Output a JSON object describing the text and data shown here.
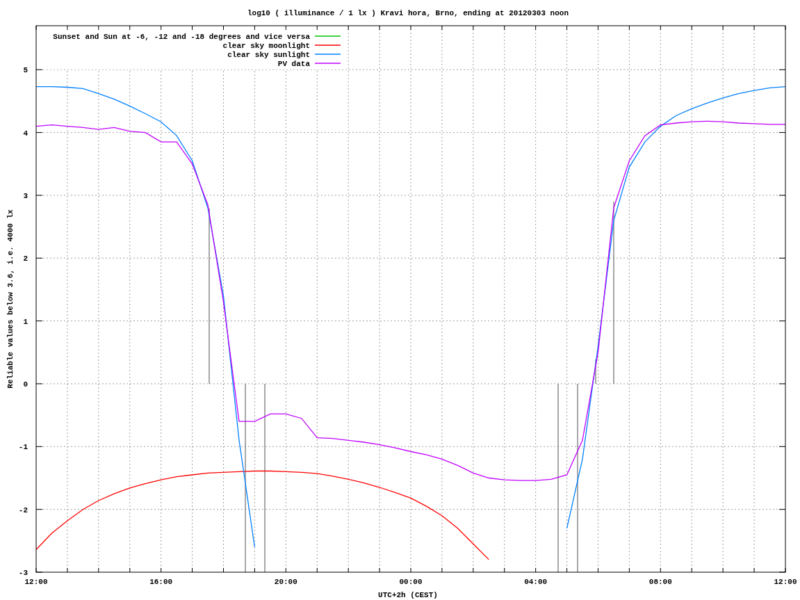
{
  "chart_data": {
    "type": "line",
    "title": "log10 ( illuminance / 1 lx ) Kravi hora, Brno, ending at 20120303 noon",
    "xlabel": "UTC+2h (CEST)",
    "ylabel": "Reliable values below 3.6, i.e. 4000 lx",
    "ylim": [
      -3,
      5.7
    ],
    "grid": true,
    "legend": true,
    "yticks": [
      -3,
      -2,
      -1,
      0,
      1,
      2,
      3,
      4,
      5
    ],
    "categories": [
      "12:00",
      null,
      null,
      null,
      null,
      null,
      null,
      null,
      "16:00",
      null,
      null,
      null,
      null,
      null,
      null,
      null,
      "20:00",
      null,
      null,
      null,
      null,
      null,
      null,
      null,
      "00:00",
      null,
      null,
      null,
      null,
      null,
      null,
      null,
      "04:00",
      null,
      null,
      null,
      null,
      null,
      null,
      null,
      "08:00",
      null,
      null,
      null,
      null,
      null,
      null,
      null,
      "12:00"
    ],
    "series": [
      {
        "name": "Sunset and Sun at -6, -12 and -18 degrees and vice versa",
        "color": "#00c000",
        "values": [
          null,
          null,
          null,
          null,
          null,
          null,
          null,
          null,
          null,
          null,
          null,
          null,
          null,
          null,
          null,
          null,
          null,
          null,
          null,
          null,
          null,
          null,
          null,
          null,
          null,
          null,
          null,
          null,
          null,
          null,
          null,
          null,
          null,
          null,
          null,
          null,
          null,
          null,
          null,
          null,
          null,
          null,
          null,
          null,
          null,
          null,
          null,
          null,
          null
        ]
      },
      {
        "name": "clear sky moonlight",
        "color": "#ff0000",
        "values": [
          -2.64,
          -2.38,
          -2.18,
          -2.0,
          -1.86,
          -1.75,
          -1.66,
          -1.59,
          -1.53,
          -1.48,
          -1.45,
          -1.42,
          -1.41,
          -1.4,
          -1.39,
          -1.39,
          -1.4,
          -1.41,
          -1.43,
          -1.47,
          -1.52,
          -1.58,
          -1.65,
          -1.73,
          -1.82,
          -1.95,
          -2.1,
          -2.3,
          -2.55,
          -2.8,
          null,
          null,
          null,
          null,
          null,
          null,
          null,
          null,
          null,
          null,
          null,
          null,
          null,
          null,
          null,
          null,
          null,
          null,
          null
        ]
      },
      {
        "name": "clear sky sunlight",
        "color": "#0080ff",
        "values": [
          4.73,
          4.73,
          4.72,
          4.7,
          4.62,
          4.53,
          4.42,
          4.3,
          4.17,
          3.95,
          3.55,
          2.8,
          1.4,
          -0.9,
          -2.6,
          null,
          null,
          null,
          null,
          null,
          null,
          null,
          null,
          null,
          null,
          null,
          null,
          null,
          null,
          null,
          null,
          null,
          null,
          null,
          -2.3,
          -1.2,
          0.6,
          2.6,
          3.45,
          3.85,
          4.1,
          4.27,
          4.38,
          4.47,
          4.55,
          4.62,
          4.67,
          4.71,
          4.73
        ]
      },
      {
        "name": "PV data",
        "color": "#c000ff",
        "values": [
          4.1,
          4.12,
          4.1,
          4.08,
          4.05,
          4.08,
          4.02,
          4.0,
          3.85,
          3.85,
          3.5,
          2.85,
          1.3,
          -0.6,
          -0.6,
          -0.48,
          -0.48,
          -0.55,
          -0.86,
          -0.87,
          -0.9,
          -0.93,
          -0.97,
          -1.02,
          -1.08,
          -1.13,
          -1.2,
          -1.3,
          -1.42,
          -1.5,
          -1.53,
          -1.54,
          -1.54,
          -1.52,
          -1.45,
          -0.9,
          0.5,
          2.8,
          3.55,
          3.95,
          4.12,
          4.15,
          4.17,
          4.18,
          4.17,
          4.15,
          4.14,
          4.13,
          4.13
        ]
      }
    ]
  }
}
